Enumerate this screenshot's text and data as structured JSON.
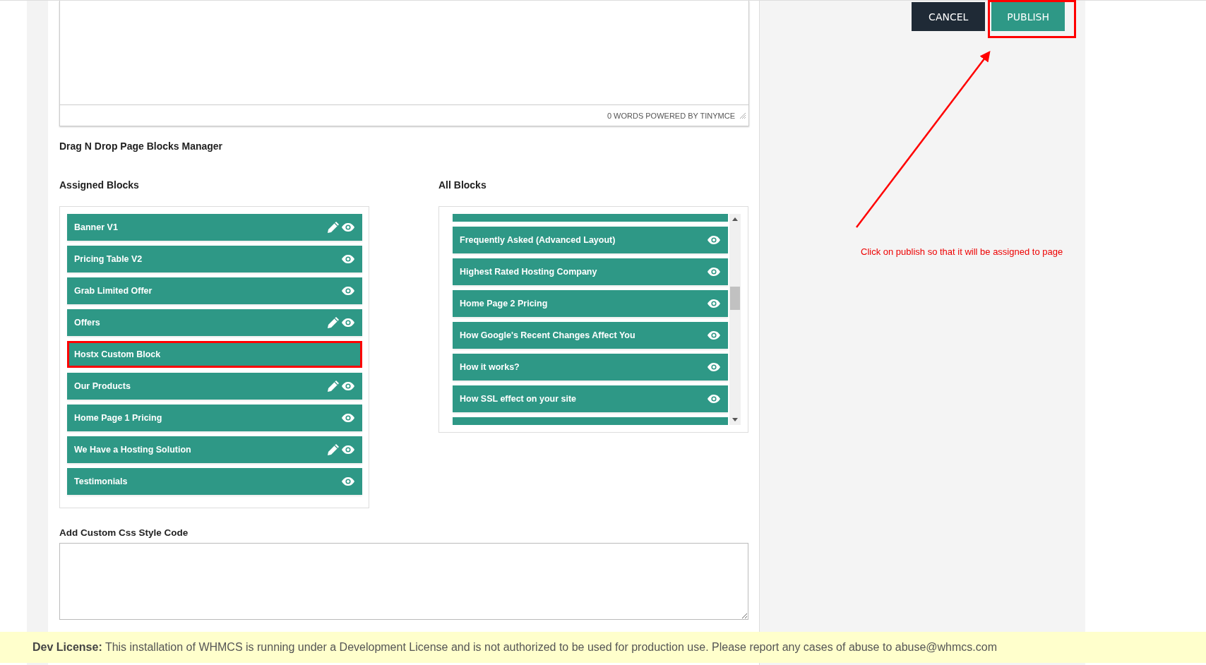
{
  "editor": {
    "status": "0 WORDS POWERED BY TINYMCE"
  },
  "blocks_manager": {
    "title": "Drag N Drop Page Blocks Manager",
    "assigned": {
      "title": "Assigned Blocks",
      "items": [
        {
          "label": "Banner V1",
          "editable": true,
          "previewable": true,
          "highlighted": false
        },
        {
          "label": "Pricing Table V2",
          "editable": false,
          "previewable": true,
          "highlighted": false
        },
        {
          "label": "Grab Limited Offer",
          "editable": false,
          "previewable": true,
          "highlighted": false
        },
        {
          "label": "Offers",
          "editable": true,
          "previewable": true,
          "highlighted": false
        },
        {
          "label": "Hostx Custom Block",
          "editable": false,
          "previewable": false,
          "highlighted": true
        },
        {
          "label": "Our Products",
          "editable": true,
          "previewable": true,
          "highlighted": false
        },
        {
          "label": "Home Page 1 Pricing",
          "editable": false,
          "previewable": true,
          "highlighted": false
        },
        {
          "label": "We Have a Hosting Solution",
          "editable": true,
          "previewable": true,
          "highlighted": false
        },
        {
          "label": "Testimonials",
          "editable": false,
          "previewable": true,
          "highlighted": false
        }
      ]
    },
    "all": {
      "title": "All Blocks",
      "items": [
        {
          "label": "Frequently Asked (Advanced Layout)",
          "editable": false,
          "previewable": true,
          "highlighted": false
        },
        {
          "label": "Highest Rated Hosting Company",
          "editable": false,
          "previewable": true,
          "highlighted": false
        },
        {
          "label": "Home Page 2 Pricing",
          "editable": false,
          "previewable": true,
          "highlighted": false
        },
        {
          "label": "How Google's Recent Changes Affect You",
          "editable": false,
          "previewable": true,
          "highlighted": false
        },
        {
          "label": "How it works?",
          "editable": false,
          "previewable": true,
          "highlighted": false
        },
        {
          "label": "How SSL effect on your site",
          "editable": false,
          "previewable": true,
          "highlighted": false
        }
      ]
    }
  },
  "custom_css": {
    "label": "Add Custom Css Style Code"
  },
  "actions": [
    {
      "label": "CANCEL",
      "kind": "secondary",
      "highlighted": false
    },
    {
      "label": "PUBLISH",
      "kind": "primary",
      "highlighted": true
    }
  ],
  "annotation": {
    "note": "Click on publish so that it will be assigned to page"
  },
  "license_notice": "**Dev License:** This installation of WHMCS is running under a Development License and is not authorized to be used for production use. Please report any cases of abuse to abuse@whmcs.com"
}
